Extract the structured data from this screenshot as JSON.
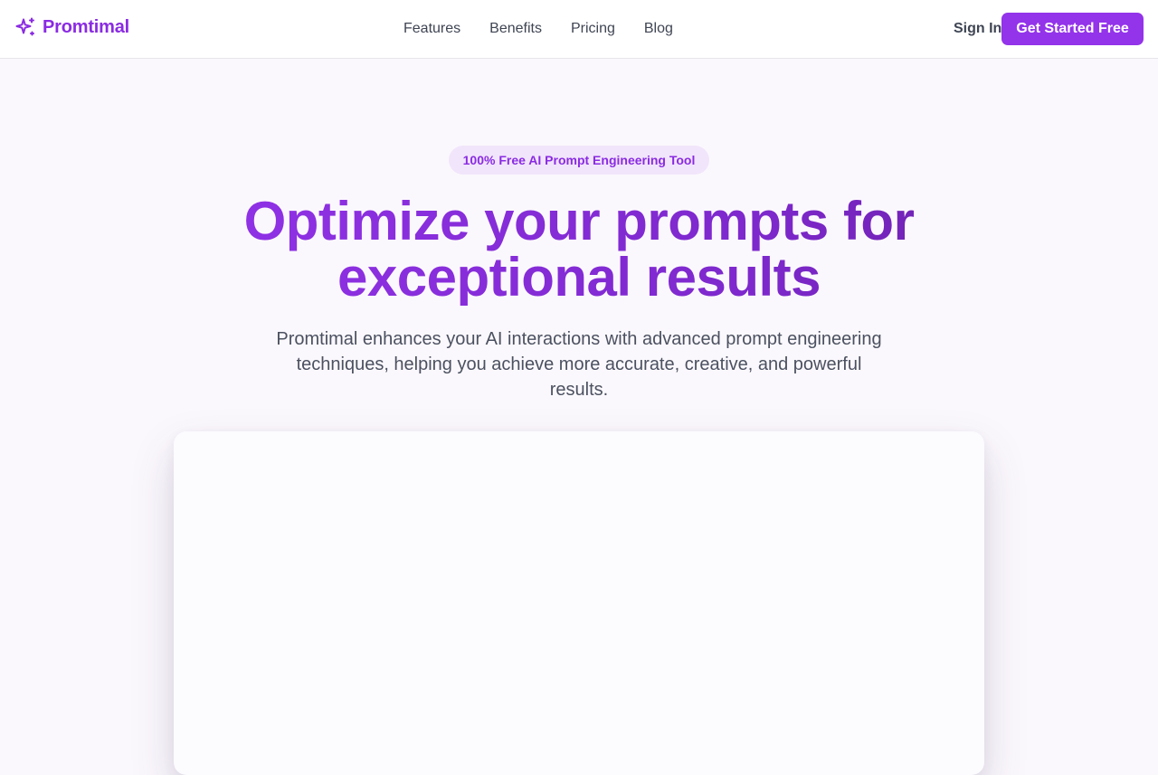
{
  "brand": {
    "name": "Promtimal",
    "icon": "sparkles-icon",
    "color": "#8a2be2"
  },
  "nav": {
    "links": [
      {
        "label": "Features"
      },
      {
        "label": "Benefits"
      },
      {
        "label": "Pricing"
      },
      {
        "label": "Blog"
      }
    ],
    "sign_in": "Sign In",
    "cta": "Get Started Free",
    "cta_color": "#9333ea"
  },
  "hero": {
    "badge": "100% Free AI Prompt Engineering Tool",
    "title_line1": "Optimize your prompts for",
    "title_line2": "exceptional results",
    "subtitle": "Promtimal enhances your AI interactions with advanced prompt engineering techniques, helping you achieve more accurate, creative, and powerful results."
  }
}
